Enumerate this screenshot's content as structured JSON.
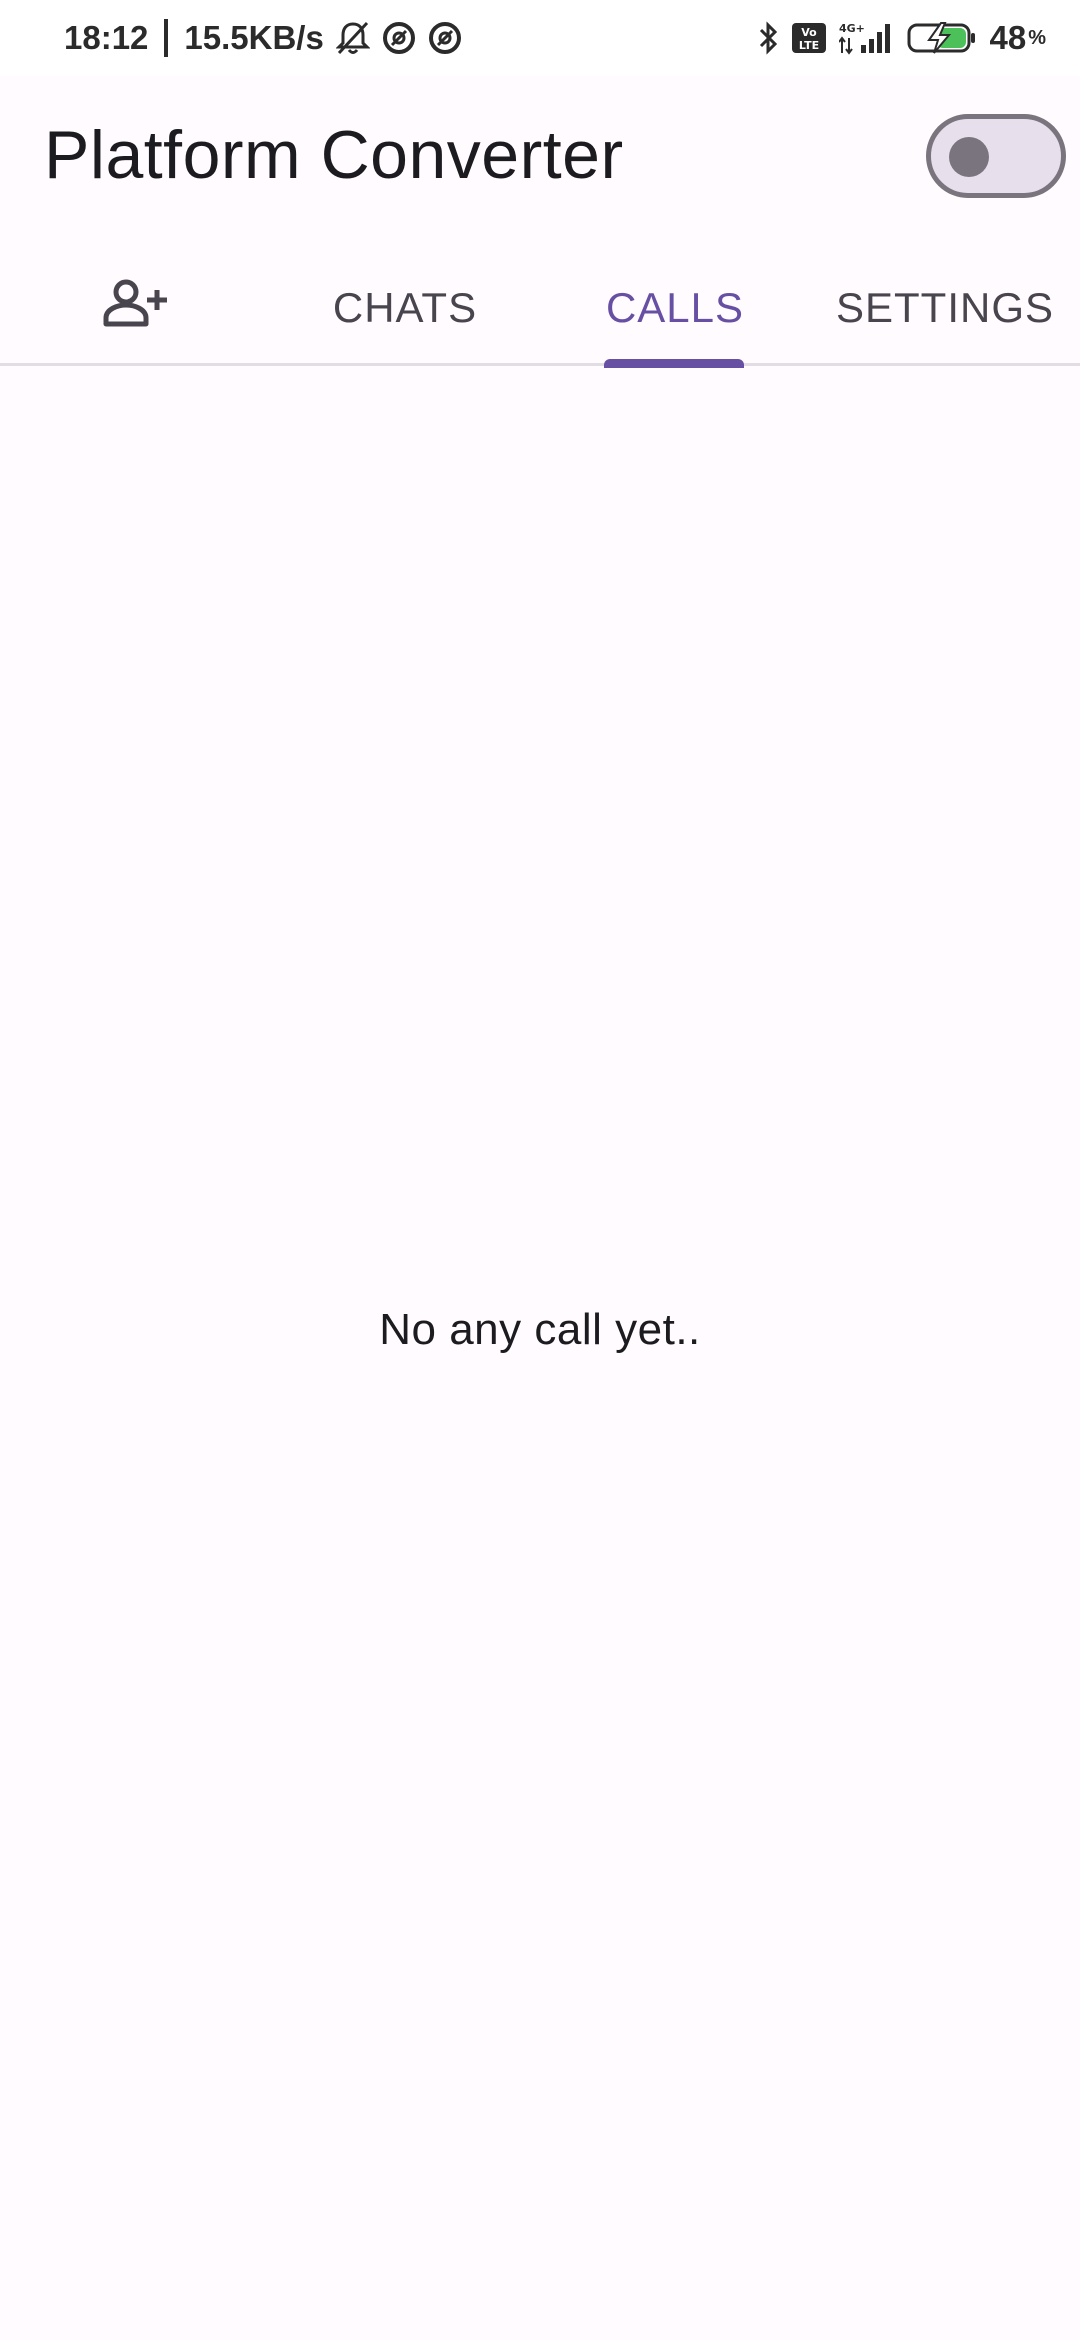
{
  "status_bar": {
    "time": "18:12",
    "network_speed": "15.5KB/s",
    "battery_level": "48",
    "battery_unit": "%",
    "icons": [
      "bell-off-icon",
      "circle-a-icon",
      "circle-a-icon",
      "bluetooth-icon",
      "volte-icon",
      "signal-4g-icon",
      "battery-charging-icon"
    ]
  },
  "app_bar": {
    "title": "Platform Converter",
    "theme_toggle_on": false
  },
  "tabs": [
    {
      "label": "",
      "icon": "add-person-icon",
      "selected": false
    },
    {
      "label": "CHATS",
      "selected": false
    },
    {
      "label": "CALLS",
      "selected": true
    },
    {
      "label": "SETTINGS",
      "selected": false
    }
  ],
  "content": {
    "empty_message": "No any call yet.."
  },
  "colors": {
    "accent": "#6750a4",
    "background": "#fffbfe",
    "tab_text": "#49454f"
  }
}
